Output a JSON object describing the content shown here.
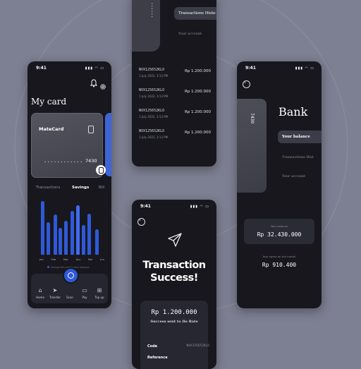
{
  "colors": {
    "background": "#7d7f92",
    "phone": "#17171d",
    "accent": "#2f59d9",
    "card": "#4b4c56"
  },
  "card_phone": {
    "time": "9:41",
    "title": "My card",
    "card_name": "MateCard",
    "card_dots": "• • • •   • • • •   • • • •",
    "card_last4": "7430",
    "tabs": [
      "Transactions",
      "Savings",
      "Bill"
    ],
    "months": [
      "Jan",
      "Feb",
      "Mar",
      "Apr",
      "Mei",
      "Jun"
    ],
    "legend": "Savings this month from balance",
    "nav": [
      {
        "label": "Home",
        "icon": "home-icon",
        "glyph": "⌂"
      },
      {
        "label": "Transfer",
        "icon": "send-icon",
        "glyph": "➤"
      },
      {
        "label": "Scan",
        "icon": "scan-icon",
        "glyph": "⊖"
      },
      {
        "label": "Pay",
        "icon": "wallet-icon",
        "glyph": "▭"
      },
      {
        "label": "Top up",
        "icon": "topup-icon",
        "glyph": "⊞"
      }
    ]
  },
  "history_phone": {
    "tab_history": "Transactions Histo",
    "tab_account": "Your account",
    "rows": [
      {
        "code": "NVX125652KLO",
        "date": "1 July 2022, 3:13 PM",
        "amount": "Rp 1.200.000"
      },
      {
        "code": "NVX125652KLO",
        "date": "1 July 2022, 3:13 PM",
        "amount": "Rp 1.200.000"
      },
      {
        "code": "NVX125652KLO",
        "date": "1 July 2022, 3:13 PM",
        "amount": "Rp 1.200.000"
      },
      {
        "code": "NVX125652KLO",
        "date": "1 July 2022, 3:13 PM",
        "amount": "Rp 1.200.000"
      }
    ]
  },
  "success_phone": {
    "time": "9:41",
    "title_line1": "Transaction",
    "title_line2": "Success!",
    "amount": "Rp 1.200.000",
    "sub": "Success sent to Ilo Rate",
    "code_label": "Code",
    "code_value": "NVX125652KLO",
    "ref_label": "Reference"
  },
  "bank_phone": {
    "time": "9:41",
    "title": "Bank",
    "card_last4": "7430",
    "menu": [
      "Your balance",
      "Transactions Hist",
      "Your account"
    ],
    "balance_label": "Your balance",
    "balance_value": "Rp 32.430.000",
    "spent_label": "Your spent on the month",
    "spent_value": "Rp 910.400"
  }
}
